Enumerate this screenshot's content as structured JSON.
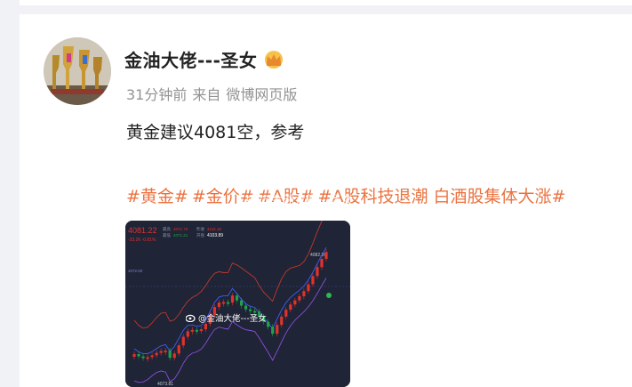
{
  "post": {
    "author": "金油大佬---圣女",
    "time": "31分钟前",
    "source_prefix": "来自",
    "source": "微博网页版",
    "text": "黄金建议4081空，参考",
    "tags": [
      "#黄金#",
      "#金价#",
      "#A股#",
      "#A股科技退潮 白酒股集体大涨#"
    ],
    "tag_watermark": "@金油大佬---圣女"
  },
  "chart_image": {
    "watermark": "@金油大佬---圣女",
    "price_main": "4081.22",
    "change_line": "-33.26  -0.81%",
    "stat_labels": [
      "最高",
      "最低",
      "昨收",
      "开盘"
    ],
    "stat_values": [
      "4071.73",
      "4071.21",
      "4115.19",
      "4103.89"
    ],
    "price_left": "4072.60",
    "price_bottom": "4073.81",
    "price_peak": "4082.26",
    "colors": {
      "bg": "#1f2436",
      "up": "#e2322c",
      "down": "#1fa24a",
      "band_upper": "#c0392b",
      "band_middle": "#3e5ef5",
      "band_lower": "#8a4fd8"
    }
  }
}
